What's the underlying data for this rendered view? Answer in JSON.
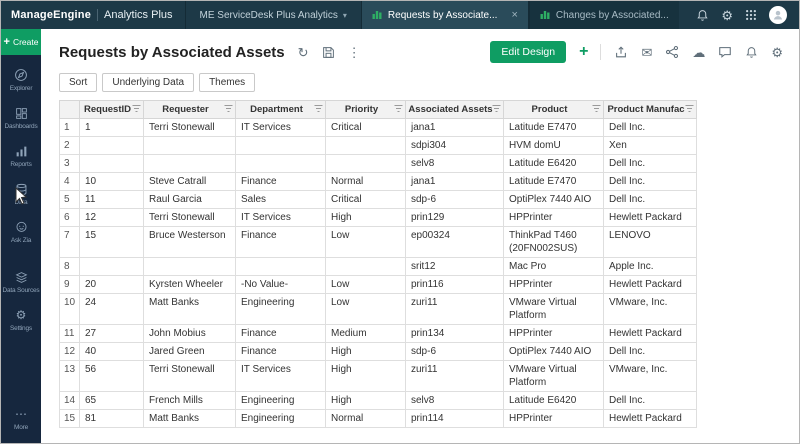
{
  "topbar": {
    "brand": "ManageEngine",
    "product": "Analytics Plus",
    "workspace": "ME ServiceDesk Plus Analytics",
    "tabs": [
      {
        "label": "Requests by Associate...",
        "active": true,
        "closable": true
      },
      {
        "label": "Changes by Associated...",
        "active": false,
        "closable": false
      }
    ]
  },
  "sidebar": {
    "create_label": "Create",
    "items": [
      {
        "label": "Explorer",
        "icon": "explorer-icon"
      },
      {
        "label": "Dashboards",
        "icon": "dashboards-icon"
      },
      {
        "label": "Reports",
        "icon": "reports-icon"
      },
      {
        "label": "Data",
        "icon": "data-icon"
      },
      {
        "label": "Ask Zia",
        "icon": "ask-zia-icon"
      },
      {
        "label": "Data Sources",
        "icon": "data-sources-icon"
      },
      {
        "label": "Settings",
        "icon": "settings-gear-icon"
      },
      {
        "label": "More",
        "icon": "more-dots-icon"
      }
    ]
  },
  "header": {
    "title": "Requests by Associated Assets",
    "edit_design_label": "Edit Design"
  },
  "toolbar": {
    "buttons": [
      "Sort",
      "Underlying Data",
      "Themes"
    ]
  },
  "table": {
    "columns": [
      "RequestID",
      "Requester",
      "Department",
      "Priority",
      "Associated Assets",
      "Product",
      "Product Manufac"
    ],
    "rows": [
      [
        "1",
        "Terri Stonewall",
        "IT Services",
        "Critical",
        "jana1",
        "Latitude E7470",
        "Dell Inc."
      ],
      [
        "",
        "",
        "",
        "",
        "sdpi304",
        "HVM domU",
        "Xen"
      ],
      [
        "",
        "",
        "",
        "",
        "selv8",
        "Latitude E6420",
        "Dell Inc."
      ],
      [
        "10",
        "Steve Catrall",
        "Finance",
        "Normal",
        "jana1",
        "Latitude E7470",
        "Dell Inc."
      ],
      [
        "11",
        "Raul Garcia",
        "Sales",
        "Critical",
        "sdp-6",
        "OptiPlex 7440 AIO",
        "Dell Inc."
      ],
      [
        "12",
        "Terri Stonewall",
        "IT Services",
        "High",
        "prin129",
        "HPPrinter",
        "Hewlett Packard"
      ],
      [
        "15",
        "Bruce Westerson",
        "Finance",
        "Low",
        "ep00324",
        "ThinkPad T460 (20FN002SUS)",
        "LENOVO"
      ],
      [
        "",
        "",
        "",
        "",
        "srit12",
        "Mac Pro",
        "Apple Inc."
      ],
      [
        "20",
        "Kyrsten Wheeler",
        "-No Value-",
        "Low",
        "prin116",
        "HPPrinter",
        "Hewlett Packard"
      ],
      [
        "24",
        "Matt Banks",
        "Engineering",
        "Low",
        "zuri11",
        "VMware Virtual Platform",
        "VMware, Inc."
      ],
      [
        "27",
        "John Mobius",
        "Finance",
        "Medium",
        "prin134",
        "HPPrinter",
        "Hewlett Packard"
      ],
      [
        "40",
        "Jared Green",
        "Finance",
        "High",
        "sdp-6",
        "OptiPlex 7440 AIO",
        "Dell Inc."
      ],
      [
        "56",
        "Terri Stonewall",
        "IT Services",
        "High",
        "zuri11",
        "VMware Virtual Platform",
        "VMware, Inc."
      ],
      [
        "65",
        "French Mills",
        "Engineering",
        "High",
        "selv8",
        "Latitude E6420",
        "Dell Inc."
      ],
      [
        "81",
        "Matt Banks",
        "Engineering",
        "Normal",
        "prin114",
        "HPPrinter",
        "Hewlett Packard"
      ]
    ]
  },
  "colors": {
    "accent_green": "#0f9d63",
    "topbar_bg": "#1d3947",
    "sidebar_bg": "#16273e",
    "table_header_bg": "#f2f2f2"
  }
}
